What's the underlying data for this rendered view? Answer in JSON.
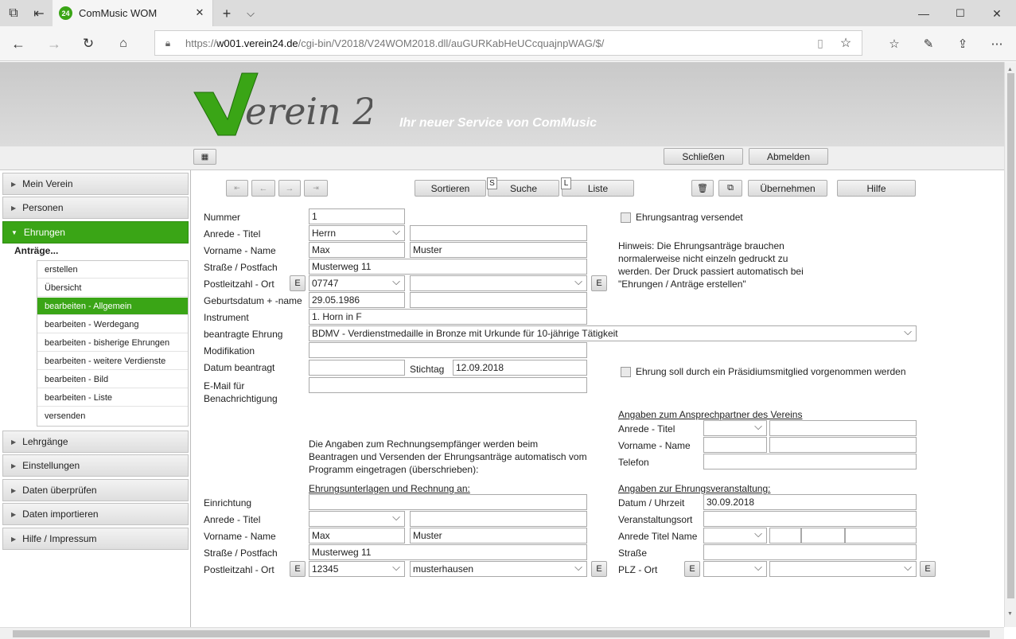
{
  "browser": {
    "tab_title": "ComMusic WOM",
    "tab_favicon": "24",
    "url_prefix": "https://",
    "url_host": "w001.verein24.de",
    "url_path": "/cgi-bin/V2018/V24WOM2018.dll/auGURKabHeUCcquajnpWAG/$/"
  },
  "header": {
    "logo_text": "Verein 24",
    "slogan": "Ihr neuer Service von ComMusic",
    "close_label": "Schließen",
    "logout_label": "Abmelden"
  },
  "toolbar": {
    "sort_label": "Sortieren",
    "search_key": "S",
    "search_label": "Suche",
    "list_key": "L",
    "list_label": "Liste",
    "apply_label": "Übernehmen",
    "help_label": "Hilfe"
  },
  "sidebar": {
    "items": [
      "Mein Verein",
      "Personen",
      "Ehrungen",
      "Lehrgänge",
      "Einstellungen",
      "Daten überprüfen",
      "Daten importieren",
      "Hilfe / Impressum"
    ],
    "group_label": "Anträge...",
    "subitems": [
      "erstellen",
      "Übersicht",
      "bearbeiten - Allgemein",
      "bearbeiten - Werdegang",
      "bearbeiten - bisherige Ehrungen",
      "bearbeiten - weitere Verdienste",
      "bearbeiten - Bild",
      "bearbeiten - Liste",
      "versenden"
    ]
  },
  "form": {
    "nummer_label": "Nummer",
    "nummer": "1",
    "anrede_label": "Anrede - Titel",
    "anrede": "Herrn",
    "titel": "",
    "name_label": "Vorname - Name",
    "vorname": "Max",
    "nachname": "Muster",
    "strasse_label": "Straße / Postfach",
    "strasse": "Musterweg 11",
    "plz_label": "Postleitzahl - Ort",
    "plz": "07747",
    "ort": "",
    "geb_label": "Geburtsdatum + -name",
    "geburtsdatum": "29.05.1986",
    "geburtsname": "",
    "instrument_label": "Instrument",
    "instrument": "1. Horn in F",
    "ehrung_label": "beantragte Ehrung",
    "ehrung": "BDMV - Verdienstmedaille in Bronze mit Urkunde für 10-jährige Tätigkeit",
    "modifikation_label": "Modifikation",
    "modifikation": "",
    "datum_label": "Datum beantragt",
    "datum": "",
    "stichtag_label": "Stichtag",
    "stichtag": "12.09.2018",
    "email_label_1": "E-Mail für",
    "email_label_2": "Benachrichtigung",
    "email": "",
    "e_label": "E"
  },
  "right": {
    "versendet_label": "Ehrungsantrag versendet",
    "hint": [
      "Hinweis: Die Ehrungsanträge brauchen",
      "normalerweise nicht einzeln gedruckt zu",
      "werden. Der Druck passiert automatisch bei",
      "\"Ehrungen / Anträge erstellen\""
    ],
    "praesidium_label": "Ehrung soll durch ein Präsidiumsmitglied vorgenommen werden",
    "contact_title": "Angaben zum Ansprechpartner des Vereins",
    "c_anrede_label": "Anrede - Titel",
    "c_name_label": "Vorname - Name",
    "c_tel_label": "Telefon",
    "event_title": "Angaben zur Ehrungsveranstaltung:",
    "e_datum_label": "Datum / Uhrzeit",
    "e_datum": "30.09.2018",
    "e_ort_label": "Veranstaltungsort",
    "e_anrede_label": "Anrede Titel Name",
    "e_strasse_label": "Straße",
    "e_plz_label": "PLZ - Ort"
  },
  "invoice": {
    "info": [
      "Die Angaben zum Rechnungsempfänger werden beim",
      "Beantragen und Versenden der Ehrungsanträge automatisch vom",
      "Programm eingetragen (überschrieben):"
    ],
    "title": "Ehrungsunterlagen und Rechnung an:",
    "einrichtung_label": "Einrichtung",
    "einrichtung": "",
    "anrede_label": "Anrede - Titel",
    "anrede": "",
    "titel": "",
    "name_label": "Vorname - Name",
    "vorname": "Max",
    "nachname": "Muster",
    "strasse_label": "Straße / Postfach",
    "strasse": "Musterweg 11",
    "plz_label": "Postleitzahl - Ort",
    "plz": "12345",
    "ort": "musterhausen"
  },
  "colors": {
    "accent": "#3aa516"
  }
}
